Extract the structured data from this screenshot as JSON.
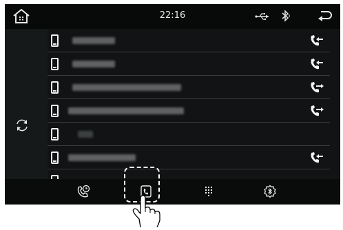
{
  "status_bar": {
    "time": "22:16",
    "icons": [
      "home-icon",
      "usb-icon",
      "bluetooth-icon",
      "back-icon"
    ]
  },
  "left_panel": {
    "icon": "refresh-icon"
  },
  "contacts": [
    {
      "label": "",
      "device_icon": "phone-icon",
      "call_type": "missed-call-icon"
    },
    {
      "label": "",
      "device_icon": "phone-icon",
      "call_type": "missed-call-icon"
    },
    {
      "label": "",
      "device_icon": "phone-icon",
      "call_type": "outgoing-call-icon"
    },
    {
      "label": "",
      "device_icon": "phone-icon",
      "call_type": "outgoing-call-icon"
    },
    {
      "label": "",
      "device_icon": "phone-icon",
      "call_type": ""
    },
    {
      "label": "",
      "device_icon": "phone-icon",
      "call_type": "missed-call-icon"
    }
  ],
  "bottom_tabs": [
    {
      "name": "recent-calls",
      "icon": "recent-calls-icon",
      "selected": false
    },
    {
      "name": "contacts",
      "icon": "phonebook-icon",
      "selected": true
    },
    {
      "name": "keypad",
      "icon": "keypad-icon",
      "selected": false
    },
    {
      "name": "bluetooth-settings",
      "icon": "bluetooth-gear-icon",
      "selected": false
    }
  ],
  "colors": {
    "background": "#111314",
    "status_bar": "#080909",
    "icon": "#ffffff",
    "divider": "#3a3d3f"
  }
}
